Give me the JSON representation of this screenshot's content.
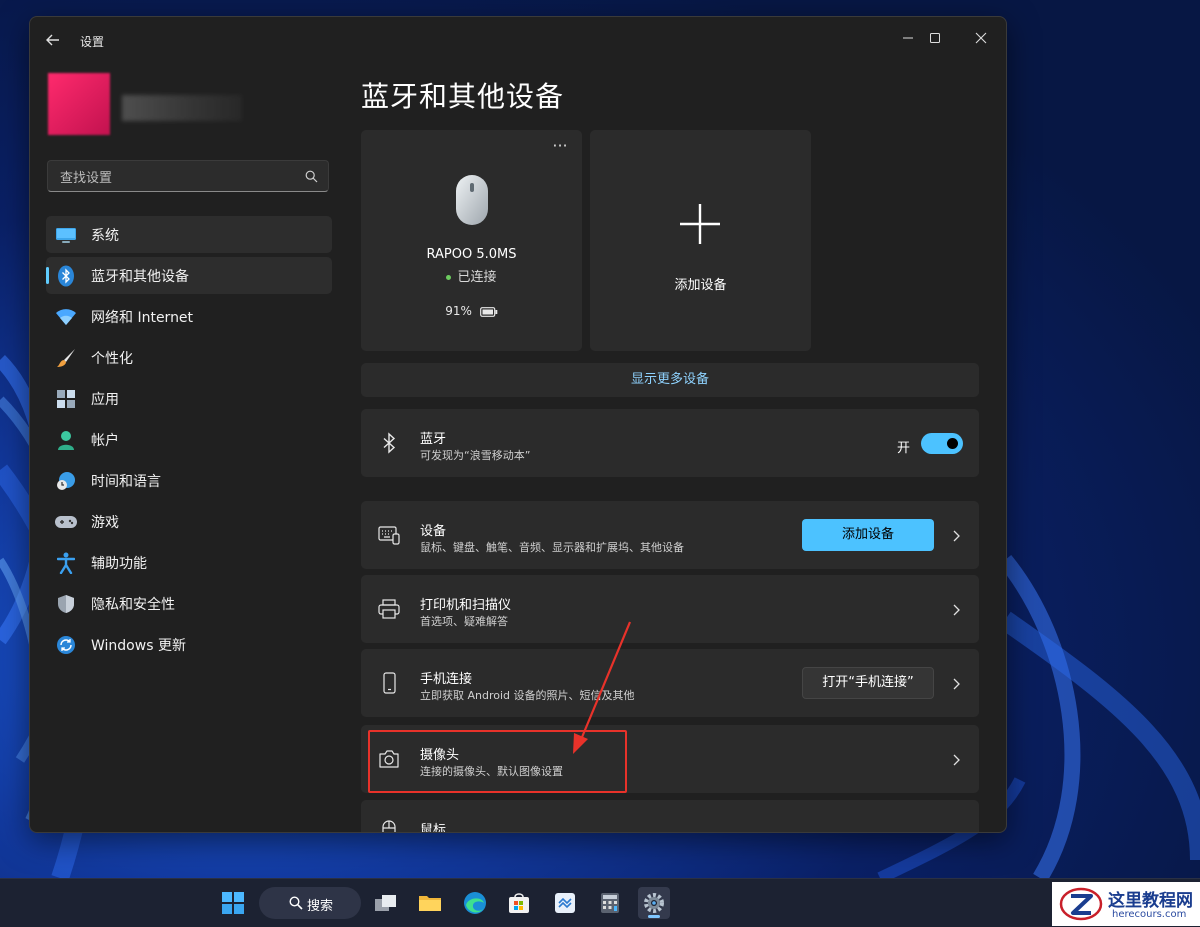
{
  "window": {
    "title": "设置"
  },
  "sidebar": {
    "search_placeholder": "查找设置",
    "items": [
      {
        "label": "系统",
        "icon": "monitor-icon"
      },
      {
        "label": "蓝牙和其他设备",
        "icon": "bluetooth-icon"
      },
      {
        "label": "网络和 Internet",
        "icon": "wifi-icon"
      },
      {
        "label": "个性化",
        "icon": "brush-icon"
      },
      {
        "label": "应用",
        "icon": "apps-icon"
      },
      {
        "label": "帐户",
        "icon": "account-icon"
      },
      {
        "label": "时间和语言",
        "icon": "clock-globe-icon"
      },
      {
        "label": "游戏",
        "icon": "gamepad-icon"
      },
      {
        "label": "辅助功能",
        "icon": "accessibility-icon"
      },
      {
        "label": "隐私和安全性",
        "icon": "shield-icon"
      },
      {
        "label": "Windows 更新",
        "icon": "update-icon"
      }
    ]
  },
  "content": {
    "title": "蓝牙和其他设备",
    "device": {
      "name": "RAPOO 5.0MS",
      "status": "已连接",
      "battery": "91%",
      "more": "···"
    },
    "add_device_card": "添加设备",
    "show_more": "显示更多设备",
    "bluetooth": {
      "title": "蓝牙",
      "subtitle": "可发现为“浪雪移动本”",
      "toggle_label": "开",
      "on": true
    },
    "rows": [
      {
        "title": "设备",
        "subtitle": "鼠标、键盘、触笔、音频、显示器和扩展坞、其他设备",
        "button": "添加设备"
      },
      {
        "title": "打印机和扫描仪",
        "subtitle": "首选项、疑难解答"
      },
      {
        "title": "手机连接",
        "subtitle": "立即获取 Android 设备的照片、短信及其他",
        "button": "打开“手机连接”"
      },
      {
        "title": "摄像头",
        "subtitle": "连接的摄像头、默认图像设置"
      },
      {
        "title": "鼠标"
      }
    ]
  },
  "taskbar": {
    "search_label": "搜索"
  },
  "watermark": {
    "title": "这里教程网",
    "url": "herecours.com"
  },
  "colors": {
    "accent": "#4cc2ff",
    "highlight": "#e8322a",
    "window_bg": "#202020",
    "card_bg": "#2b2b2b"
  }
}
